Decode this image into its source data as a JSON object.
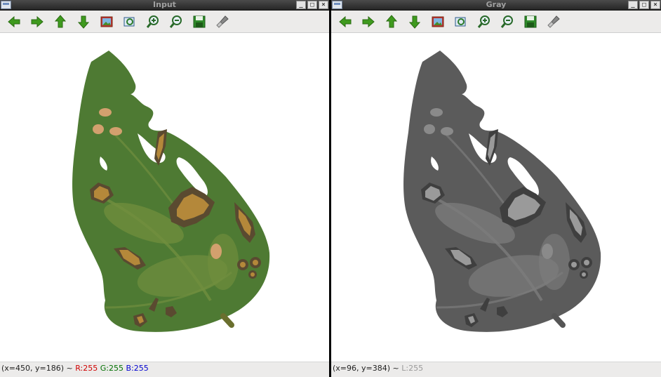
{
  "windows": [
    {
      "title": "Input",
      "status": {
        "coords": "(x=450, y=186) ~ ",
        "r": "R:255",
        "g": "G:255",
        "b": "B:255"
      }
    },
    {
      "title": "Gray",
      "status": {
        "coords": "(x=96, y=384) ~ ",
        "l": "L:255"
      }
    }
  ],
  "toolbar_icons": [
    "arrow-left-icon",
    "arrow-right-icon",
    "arrow-up-icon",
    "arrow-down-icon",
    "image-icon",
    "zoom-region-icon",
    "zoom-in-icon",
    "zoom-out-icon",
    "save-icon",
    "properties-brush-icon"
  ],
  "colors": {
    "leaf": "#4e7a33",
    "leaf_patch": "#718f3e",
    "lesion_dark": "#5a4a30",
    "lesion_fill": "#b4883a",
    "spot": "#d2a06e",
    "gray_leaf": "#5b5b5b",
    "gray_patch": "#7c7c7c",
    "gray_dark": "#3f3f3f",
    "gray_fill": "#9a9a9a"
  }
}
